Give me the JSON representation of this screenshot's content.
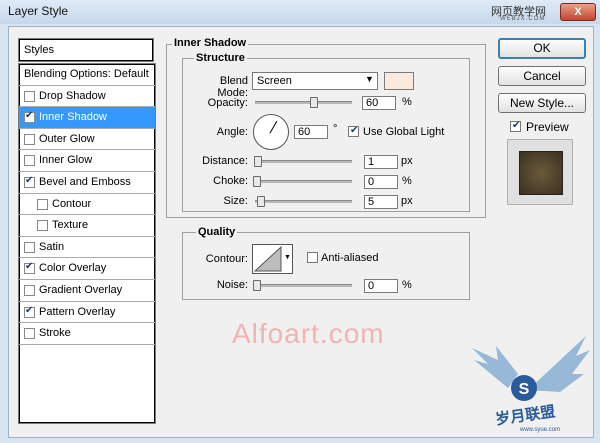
{
  "window": {
    "title": "Layer Style",
    "close": "X",
    "site_badge": "网页教学网",
    "site_sub": "WEBJX.COM"
  },
  "left_panel": {
    "header": "Styles",
    "items": [
      {
        "label": "Blending Options: Default",
        "checkbox": false,
        "checked": false,
        "selected": false,
        "indent": false
      },
      {
        "label": "Drop Shadow",
        "checkbox": true,
        "checked": false,
        "selected": false,
        "indent": false
      },
      {
        "label": "Inner Shadow",
        "checkbox": true,
        "checked": true,
        "selected": true,
        "indent": false
      },
      {
        "label": "Outer Glow",
        "checkbox": true,
        "checked": false,
        "selected": false,
        "indent": false
      },
      {
        "label": "Inner Glow",
        "checkbox": true,
        "checked": false,
        "selected": false,
        "indent": false
      },
      {
        "label": "Bevel and Emboss",
        "checkbox": true,
        "checked": true,
        "selected": false,
        "indent": false
      },
      {
        "label": "Contour",
        "checkbox": true,
        "checked": false,
        "selected": false,
        "indent": true
      },
      {
        "label": "Texture",
        "checkbox": true,
        "checked": false,
        "selected": false,
        "indent": true
      },
      {
        "label": "Satin",
        "checkbox": true,
        "checked": false,
        "selected": false,
        "indent": false
      },
      {
        "label": "Color Overlay",
        "checkbox": true,
        "checked": true,
        "selected": false,
        "indent": false
      },
      {
        "label": "Gradient Overlay",
        "checkbox": true,
        "checked": false,
        "selected": false,
        "indent": false
      },
      {
        "label": "Pattern Overlay",
        "checkbox": true,
        "checked": true,
        "selected": false,
        "indent": false
      },
      {
        "label": "Stroke",
        "checkbox": true,
        "checked": false,
        "selected": false,
        "indent": false
      }
    ]
  },
  "inner_shadow": {
    "section_title": "Inner Shadow",
    "structure_title": "Structure",
    "blend_mode_label": "Blend Mode:",
    "blend_mode_value": "Screen",
    "color_swatch": "#fbe9df",
    "opacity_label": "Opacity:",
    "opacity_value": "60",
    "opacity_unit": "%",
    "opacity_fraction": 0.6,
    "angle_label": "Angle:",
    "angle_value": "60",
    "angle_unit": "°",
    "use_global_light_label": "Use Global Light",
    "use_global_light": true,
    "distance_label": "Distance:",
    "distance_value": "1",
    "distance_unit": "px",
    "distance_fraction": 0.0,
    "choke_label": "Choke:",
    "choke_value": "0",
    "choke_unit": "%",
    "choke_fraction": 0.0,
    "size_label": "Size:",
    "size_value": "5",
    "size_unit": "px",
    "size_fraction": 0.02,
    "quality_title": "Quality",
    "contour_label": "Contour:",
    "anti_aliased_label": "Anti-aliased",
    "anti_aliased": false,
    "noise_label": "Noise:",
    "noise_value": "0",
    "noise_unit": "%",
    "noise_fraction": 0.0
  },
  "buttons": {
    "ok": "OK",
    "cancel": "Cancel",
    "new_style": "New Style..."
  },
  "preview": {
    "label": "Preview",
    "checked": true
  },
  "watermarks": {
    "main": "Alfoart.com",
    "logo_text": "岁月联盟",
    "logo_sub": "www.syue.com"
  },
  "colors": {
    "selection": "#3399ff",
    "accent": "#3c7fb1"
  }
}
